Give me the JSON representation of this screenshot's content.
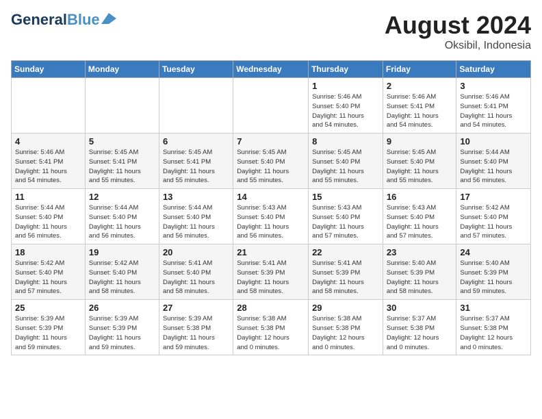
{
  "header": {
    "logo_general": "General",
    "logo_blue": "Blue",
    "month_year": "August 2024",
    "location": "Oksibil, Indonesia"
  },
  "days_of_week": [
    "Sunday",
    "Monday",
    "Tuesday",
    "Wednesday",
    "Thursday",
    "Friday",
    "Saturday"
  ],
  "weeks": [
    [
      {
        "day": "",
        "info": ""
      },
      {
        "day": "",
        "info": ""
      },
      {
        "day": "",
        "info": ""
      },
      {
        "day": "",
        "info": ""
      },
      {
        "day": "1",
        "info": "Sunrise: 5:46 AM\nSunset: 5:40 PM\nDaylight: 11 hours\nand 54 minutes."
      },
      {
        "day": "2",
        "info": "Sunrise: 5:46 AM\nSunset: 5:41 PM\nDaylight: 11 hours\nand 54 minutes."
      },
      {
        "day": "3",
        "info": "Sunrise: 5:46 AM\nSunset: 5:41 PM\nDaylight: 11 hours\nand 54 minutes."
      }
    ],
    [
      {
        "day": "4",
        "info": "Sunrise: 5:46 AM\nSunset: 5:41 PM\nDaylight: 11 hours\nand 54 minutes."
      },
      {
        "day": "5",
        "info": "Sunrise: 5:45 AM\nSunset: 5:41 PM\nDaylight: 11 hours\nand 55 minutes."
      },
      {
        "day": "6",
        "info": "Sunrise: 5:45 AM\nSunset: 5:41 PM\nDaylight: 11 hours\nand 55 minutes."
      },
      {
        "day": "7",
        "info": "Sunrise: 5:45 AM\nSunset: 5:40 PM\nDaylight: 11 hours\nand 55 minutes."
      },
      {
        "day": "8",
        "info": "Sunrise: 5:45 AM\nSunset: 5:40 PM\nDaylight: 11 hours\nand 55 minutes."
      },
      {
        "day": "9",
        "info": "Sunrise: 5:45 AM\nSunset: 5:40 PM\nDaylight: 11 hours\nand 55 minutes."
      },
      {
        "day": "10",
        "info": "Sunrise: 5:44 AM\nSunset: 5:40 PM\nDaylight: 11 hours\nand 56 minutes."
      }
    ],
    [
      {
        "day": "11",
        "info": "Sunrise: 5:44 AM\nSunset: 5:40 PM\nDaylight: 11 hours\nand 56 minutes."
      },
      {
        "day": "12",
        "info": "Sunrise: 5:44 AM\nSunset: 5:40 PM\nDaylight: 11 hours\nand 56 minutes."
      },
      {
        "day": "13",
        "info": "Sunrise: 5:44 AM\nSunset: 5:40 PM\nDaylight: 11 hours\nand 56 minutes."
      },
      {
        "day": "14",
        "info": "Sunrise: 5:43 AM\nSunset: 5:40 PM\nDaylight: 11 hours\nand 56 minutes."
      },
      {
        "day": "15",
        "info": "Sunrise: 5:43 AM\nSunset: 5:40 PM\nDaylight: 11 hours\nand 57 minutes."
      },
      {
        "day": "16",
        "info": "Sunrise: 5:43 AM\nSunset: 5:40 PM\nDaylight: 11 hours\nand 57 minutes."
      },
      {
        "day": "17",
        "info": "Sunrise: 5:42 AM\nSunset: 5:40 PM\nDaylight: 11 hours\nand 57 minutes."
      }
    ],
    [
      {
        "day": "18",
        "info": "Sunrise: 5:42 AM\nSunset: 5:40 PM\nDaylight: 11 hours\nand 57 minutes."
      },
      {
        "day": "19",
        "info": "Sunrise: 5:42 AM\nSunset: 5:40 PM\nDaylight: 11 hours\nand 58 minutes."
      },
      {
        "day": "20",
        "info": "Sunrise: 5:41 AM\nSunset: 5:40 PM\nDaylight: 11 hours\nand 58 minutes."
      },
      {
        "day": "21",
        "info": "Sunrise: 5:41 AM\nSunset: 5:39 PM\nDaylight: 11 hours\nand 58 minutes."
      },
      {
        "day": "22",
        "info": "Sunrise: 5:41 AM\nSunset: 5:39 PM\nDaylight: 11 hours\nand 58 minutes."
      },
      {
        "day": "23",
        "info": "Sunrise: 5:40 AM\nSunset: 5:39 PM\nDaylight: 11 hours\nand 58 minutes."
      },
      {
        "day": "24",
        "info": "Sunrise: 5:40 AM\nSunset: 5:39 PM\nDaylight: 11 hours\nand 59 minutes."
      }
    ],
    [
      {
        "day": "25",
        "info": "Sunrise: 5:39 AM\nSunset: 5:39 PM\nDaylight: 11 hours\nand 59 minutes."
      },
      {
        "day": "26",
        "info": "Sunrise: 5:39 AM\nSunset: 5:39 PM\nDaylight: 11 hours\nand 59 minutes."
      },
      {
        "day": "27",
        "info": "Sunrise: 5:39 AM\nSunset: 5:38 PM\nDaylight: 11 hours\nand 59 minutes."
      },
      {
        "day": "28",
        "info": "Sunrise: 5:38 AM\nSunset: 5:38 PM\nDaylight: 12 hours\nand 0 minutes."
      },
      {
        "day": "29",
        "info": "Sunrise: 5:38 AM\nSunset: 5:38 PM\nDaylight: 12 hours\nand 0 minutes."
      },
      {
        "day": "30",
        "info": "Sunrise: 5:37 AM\nSunset: 5:38 PM\nDaylight: 12 hours\nand 0 minutes."
      },
      {
        "day": "31",
        "info": "Sunrise: 5:37 AM\nSunset: 5:38 PM\nDaylight: 12 hours\nand 0 minutes."
      }
    ]
  ]
}
